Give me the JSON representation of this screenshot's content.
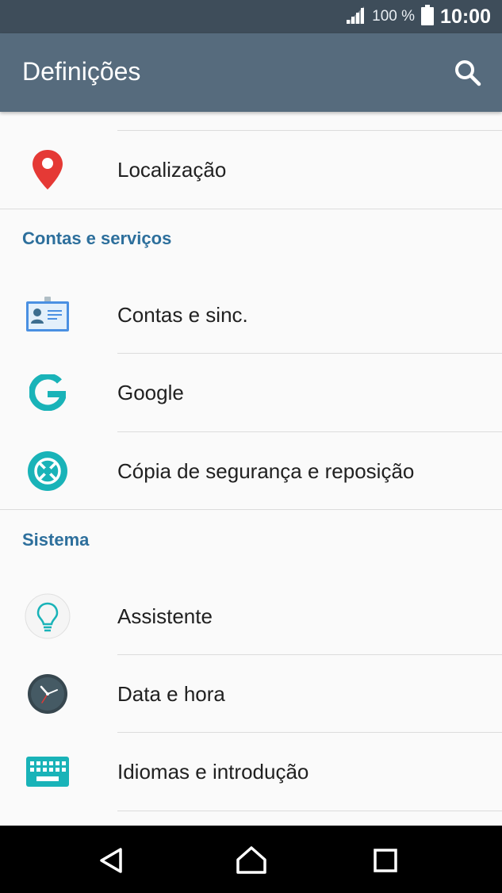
{
  "status_bar": {
    "battery_percent": "100 %",
    "time": "10:00"
  },
  "app_bar": {
    "title": "Definições"
  },
  "items": {
    "location": "Localização",
    "accounts_sync": "Contas e sinc.",
    "google": "Google",
    "backup_reset": "Cópia de segurança e reposição",
    "assistant": "Assistente",
    "date_time": "Data e hora",
    "languages_input": "Idiomas e introdução"
  },
  "sections": {
    "accounts_services": "Contas e serviços",
    "system": "Sistema"
  },
  "colors": {
    "status_bar": "#3e4d5a",
    "app_bar": "#566b7d",
    "section_header": "#2d6f9c",
    "location_pin": "#e53935",
    "teal": "#19b3b8"
  }
}
